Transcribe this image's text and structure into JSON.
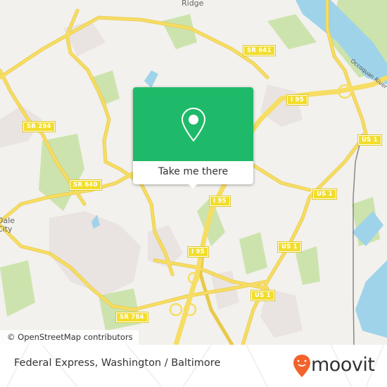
{
  "map": {
    "place_labels": [
      "Ridge",
      "Dale City"
    ],
    "river_label": "Occoquan River",
    "road_shields": [
      "SR 641",
      "SR 294",
      "SR 640",
      "I 95",
      "I 95",
      "I 95",
      "US 1",
      "US 1",
      "US 1",
      "US 1",
      "SR 784"
    ],
    "attribution": "© OpenStreetMap contributors",
    "colors": {
      "background": "#f2f1ed",
      "road": "#f6dd63",
      "shield": "#f2dd2b",
      "park": "#cde3ad",
      "water": "#9fd3ea",
      "urban": "#e9e3e1"
    }
  },
  "popup": {
    "icon": "location-pin-icon",
    "action_label": "Take me there",
    "color": "#1fba69"
  },
  "footer": {
    "title": "Federal Express, Washington / Baltimore",
    "brand": "moovit",
    "brand_icon": "moovit-pin-icon",
    "brand_color": "#f4622c"
  }
}
